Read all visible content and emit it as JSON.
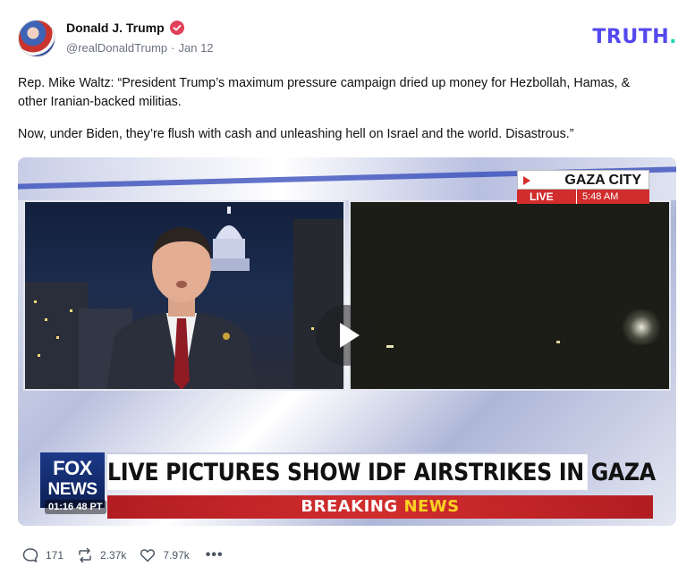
{
  "author": {
    "name": "Donald J. Trump",
    "handle": "@realDonaldTrump",
    "separator": "·",
    "date": "Jan 12",
    "verified": true
  },
  "brand": {
    "logo_text": "TRUTH",
    "logo_dot": ".",
    "colors": {
      "primary": "#5448ee",
      "dot": "#22d3b8"
    }
  },
  "post": {
    "paragraphs": [
      "Rep. Mike Waltz: “President Trump’s maximum pressure campaign dried up money for Hezbollah, Hamas, & other Iranian-backed militias.",
      "Now, under Biden, they’re flush with cash and unleashing hell on Israel and the world. Disastrous.”"
    ]
  },
  "video": {
    "location_title": "GAZA CITY",
    "live_label": "LIVE",
    "live_time": "5:48 AM",
    "network_logo_line1": "FOX",
    "network_logo_line2": "NEWS",
    "headline": "LIVE PICTURES SHOW IDF AIRSTRIKES IN GAZA",
    "breaking_label": "BREAKING",
    "breaking_news_word": "NEWS",
    "timestamp": "01:16",
    "timestamp_suffix": "48 PT",
    "play_icon": "play-icon",
    "colors": {
      "breaking_red": "#d12d2d",
      "news_yellow": "#f9d223",
      "fox_blue": "#1c3a8a"
    }
  },
  "actions": {
    "replies": "171",
    "retruths": "2.37k",
    "likes": "7.97k",
    "more_label": "•••",
    "icons": [
      "reply-icon",
      "retruth-icon",
      "like-icon",
      "more-icon"
    ]
  }
}
